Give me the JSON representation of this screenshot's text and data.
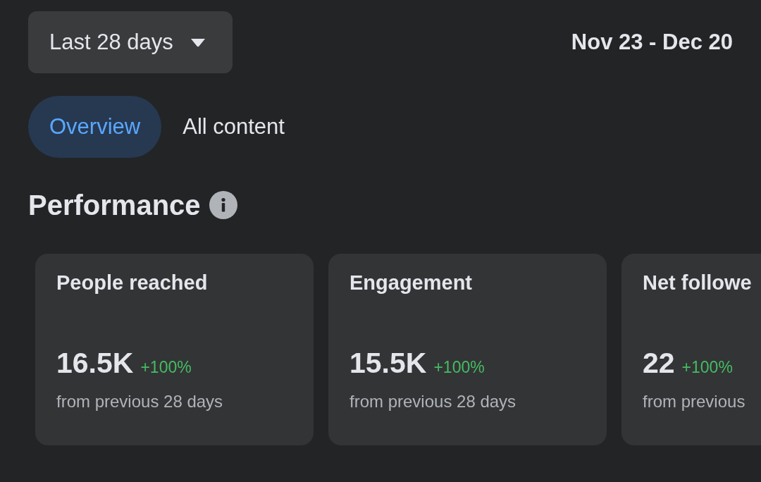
{
  "date_range_picker": {
    "label": "Last 28 days"
  },
  "date_range": "Nov 23 - Dec 20",
  "tabs": [
    {
      "label": "Overview",
      "selected": true
    },
    {
      "label": "All content",
      "selected": false
    }
  ],
  "section": {
    "title": "Performance"
  },
  "metric_cards": [
    {
      "title": "People reached",
      "value": "16.5K",
      "change": "+100%",
      "caption": "from previous 28 days"
    },
    {
      "title": "Engagement",
      "value": "15.5K",
      "change": "+100%",
      "caption": "from previous 28 days"
    },
    {
      "title": "Net followe",
      "value": "22",
      "change": "+100%",
      "caption": "from previous"
    }
  ]
}
